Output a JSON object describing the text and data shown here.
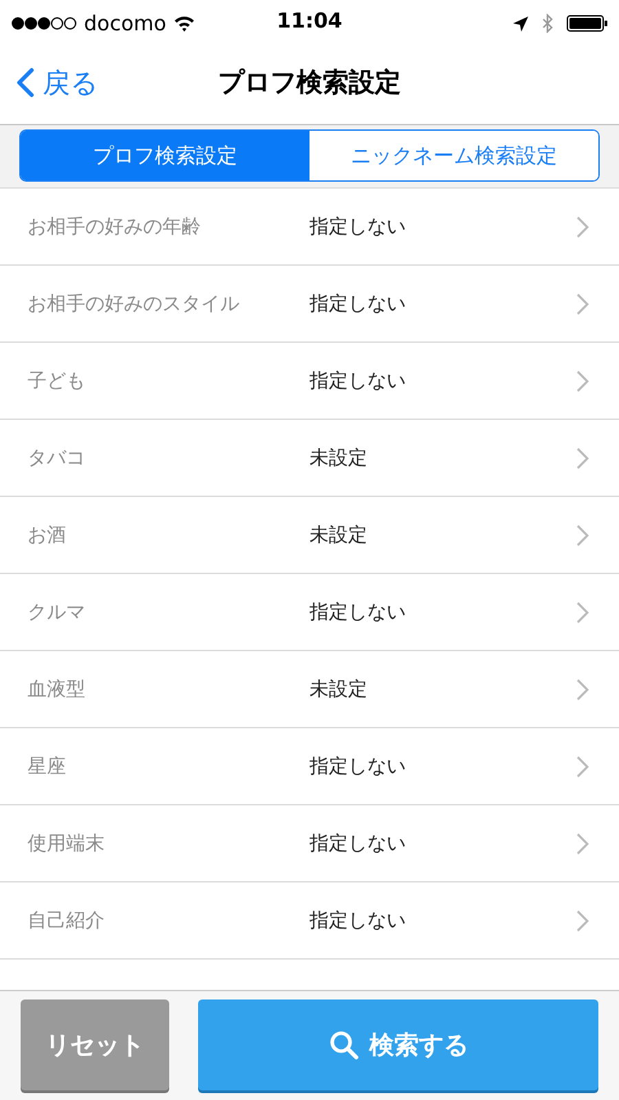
{
  "status_bar": {
    "carrier": "docomo",
    "time": "11:04"
  },
  "nav": {
    "back": "戻る",
    "title": "プロフ検索設定"
  },
  "tabs": [
    {
      "label": "プロフ検索設定",
      "selected": true
    },
    {
      "label": "ニックネーム検索設定",
      "selected": false
    }
  ],
  "rows": [
    {
      "label": "お相手の好みの年齢",
      "value": "指定しない"
    },
    {
      "label": "お相手の好みのスタイル",
      "value": "指定しない"
    },
    {
      "label": "子ども",
      "value": "指定しない"
    },
    {
      "label": "タバコ",
      "value": "未設定"
    },
    {
      "label": "お酒",
      "value": "未設定"
    },
    {
      "label": "クルマ",
      "value": "指定しない"
    },
    {
      "label": "血液型",
      "value": "未設定"
    },
    {
      "label": "星座",
      "value": "指定しない"
    },
    {
      "label": "使用端末",
      "value": "指定しない"
    },
    {
      "label": "自己紹介",
      "value": "指定しない"
    }
  ],
  "buttons": {
    "reset": "リセット",
    "search": "検索する"
  }
}
